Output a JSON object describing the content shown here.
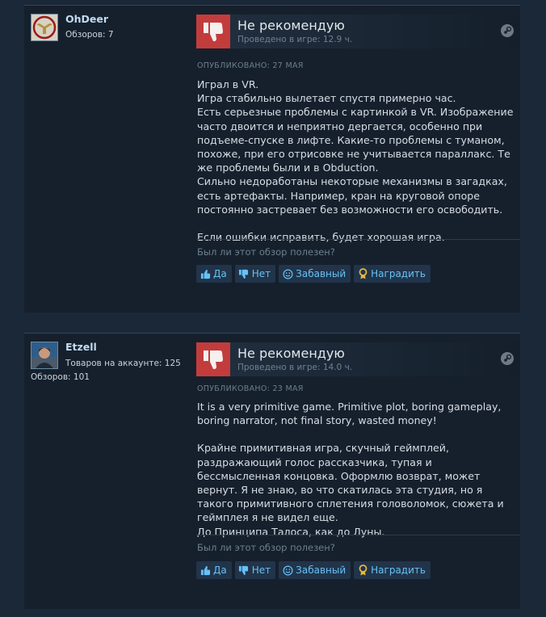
{
  "reviews": [
    {
      "author": {
        "name": "OhDeer",
        "stats": [
          "Обзоров: 7"
        ]
      },
      "verdict": "Не рекомендую",
      "playtime": "Проведено в игре: 12.9 ч.",
      "posted": "ОПУБЛИКОВАНО: 27 МАЯ",
      "body": [
        "Играл в VR.",
        "Игра стабильно вылетает спустя примерно час.",
        "Есть серьезные проблемы с картинкой в VR. Изображение часто двоится и неприятно дергается, особенно при подъеме-спуске в лифте. Какие-то проблемы с туманом, похоже, при его отрисовке не учитывается параллакс. Те же проблемы были и в Obduction.",
        "Сильно недоработаны некоторые механизмы в загадках, есть артефакты. Например, кран на круговой опоре постоянно застревает без возможности его освободить.",
        "",
        "Если ошибки исправить, будет хорошая игра."
      ],
      "helpful_question": "Был ли этот обзор полезен?",
      "buttons": {
        "yes": "Да",
        "no": "Нет",
        "funny": "Забавный",
        "award": "Наградить"
      }
    },
    {
      "author": {
        "name": "Etzell",
        "stats": [
          "Товаров на аккаунте: 125",
          "Обзоров: 101"
        ]
      },
      "verdict": "Не рекомендую",
      "playtime": "Проведено в игре: 14.0 ч.",
      "posted": "ОПУБЛИКОВАНО: 23 МАЯ",
      "body": [
        "It is a very primitive game. Primitive plot, boring gameplay, boring narrator, not final story, wasted money!",
        "",
        "Крайне примитивная игра, скучный геймплей, раздражающий голос рассказчика, тупая и бессмысленная концовка. Оформлю возврат, может вернут. Я не знаю, во что скатилась эта студия, но я такого примитивного сплетения головоломок, сюжета и геймплея я не видел еще.",
        "До Принципа Талоса, как до Луны."
      ],
      "helpful_question": "Был ли этот обзор полезен?",
      "buttons": {
        "yes": "Да",
        "no": "Нет",
        "funny": "Забавный",
        "award": "Наградить"
      }
    }
  ],
  "colors": {
    "page_bg": "#1b2838",
    "card_bg": "#16202d",
    "thumb_down_bg": "#c33c3c",
    "link_blue": "#67c1f5",
    "author_name": "#c1dbf4",
    "award_gold": "#e8b73c"
  },
  "icons": {
    "verdict": "thumbs-down-icon",
    "steam": "steam-logo-icon",
    "yes": "thumbs-up-icon",
    "no": "thumbs-down-icon",
    "funny": "smiley-icon",
    "award": "award-ribbon-icon"
  }
}
